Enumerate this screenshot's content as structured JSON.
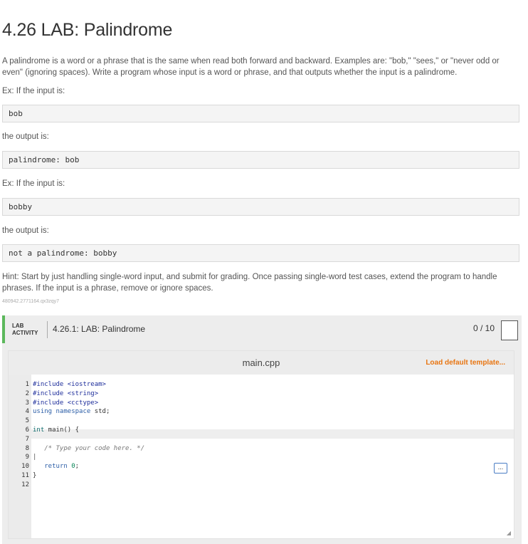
{
  "page": {
    "title": "4.26 LAB: Palindrome",
    "description": "A palindrome is a word or a phrase that is the same when read both forward and backward. Examples are: \"bob,\" \"sees,\" or \"never odd or even\" (ignoring spaces). Write a program whose input is a word or phrase, and that outputs whether the input is a palindrome.",
    "example1_intro": "Ex: If the input is:",
    "example1_input": "bob",
    "example1_output_label": "the output is:",
    "example1_output": "palindrome: bob",
    "example2_intro": "Ex: If the input is:",
    "example2_input": "bobby",
    "example2_output_label": "the output is:",
    "example2_output": "not a palindrome: bobby",
    "hint": "Hint: Start by just handling single-word input, and submit for grading. Once passing single-word test cases, extend the program to handle phrases. If the input is a phrase, remove or ignore spaces.",
    "id_line": "480942.2771164.qx3zqy7"
  },
  "lab": {
    "tag_line1": "LAB",
    "tag_line2": "ACTIVITY",
    "name": "4.26.1: LAB: Palindrome",
    "score": "0 / 10",
    "accent_color": "#5cb85c"
  },
  "editor": {
    "filename": "main.cpp",
    "load_default": "Load default template...",
    "more_label": "...",
    "line_numbers": "1\n2\n3\n4\n5\n6\n7\n8\n9\n10\n11\n12",
    "code_lines": [
      "#include <iostream>",
      "#include <string>",
      "#include <cctype>",
      "using namespace std;",
      "",
      "int main() {",
      "",
      "   /* Type your code here. */",
      "",
      "   return 0;",
      "}",
      ""
    ]
  }
}
